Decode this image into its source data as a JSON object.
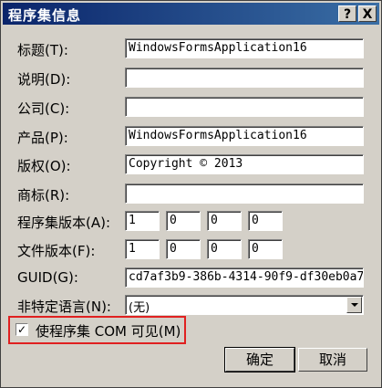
{
  "dialog": {
    "title": "程序集信息",
    "help_glyph": "?",
    "close_glyph": "X"
  },
  "fields": {
    "title": {
      "label": "标题(T):",
      "value": "WindowsFormsApplication16"
    },
    "description": {
      "label": "说明(D):",
      "value": ""
    },
    "company": {
      "label": "公司(C):",
      "value": ""
    },
    "product": {
      "label": "产品(P):",
      "value": "WindowsFormsApplication16"
    },
    "copyright": {
      "label": "版权(O):",
      "value": "Copyright ©  2013"
    },
    "trademark": {
      "label": "商标(R):",
      "value": ""
    },
    "assembly_version": {
      "label": "程序集版本(A):",
      "values": [
        "1",
        "0",
        "0",
        "0"
      ]
    },
    "file_version": {
      "label": "文件版本(F):",
      "values": [
        "1",
        "0",
        "0",
        "0"
      ]
    },
    "guid": {
      "label": "GUID(G):",
      "value": "cd7af3b9-386b-4314-90f9-df30eb0a7"
    },
    "neutral_language": {
      "label": "非特定语言(N):",
      "value": "(无)"
    }
  },
  "com_visible": {
    "label": "使程序集 COM 可见(M)",
    "checked": true,
    "check_glyph": "✓",
    "highlight_color": "#e02020"
  },
  "buttons": {
    "ok": "确定",
    "cancel": "取消"
  }
}
